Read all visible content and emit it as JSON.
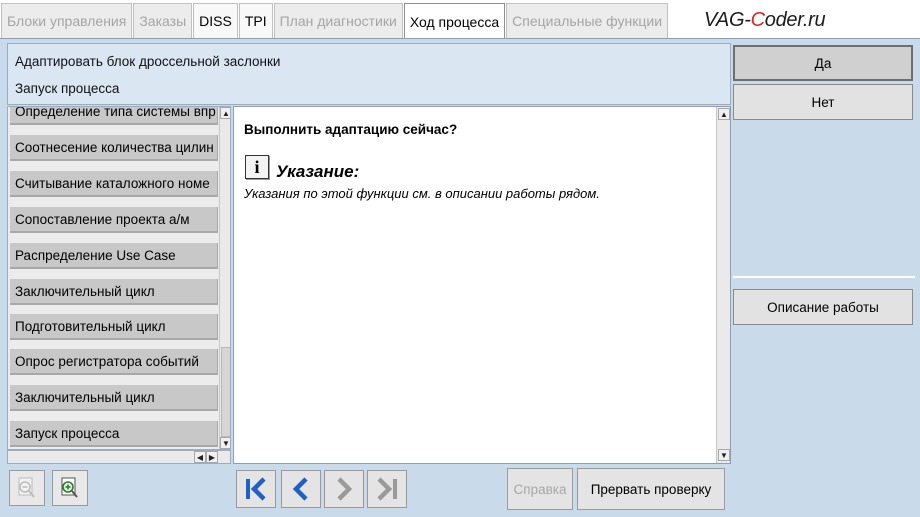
{
  "tabs": [
    {
      "label": "Блоки управления",
      "state": "disabled"
    },
    {
      "label": "Заказы",
      "state": "disabled"
    },
    {
      "label": "DISS",
      "state": "enabled"
    },
    {
      "label": "TPI",
      "state": "enabled"
    },
    {
      "label": "План диагностики",
      "state": "disabled"
    },
    {
      "label": "Ход процесса",
      "state": "active"
    },
    {
      "label": "Специальные функции",
      "state": "disabled"
    }
  ],
  "watermark": {
    "part1": "VAG-",
    "part2": "C",
    "part3": "oder.ru"
  },
  "header": {
    "line1": "Адаптировать блок дроссельной заслонки",
    "line2": "Запуск процесса"
  },
  "steps": [
    "Определение типа системы впр",
    "Соотнесение количества цилин",
    "Считывание каталожного номе",
    "Сопоставление проекта а/м",
    "Распределение Use Case",
    "Заключительный цикл",
    "Подготовительный цикл",
    "Опрос регистратора событий",
    "Заключительный цикл",
    "Запуск процесса"
  ],
  "content": {
    "question": "Выполнить адаптацию сейчас?",
    "info_glyph": "i",
    "note_title": "Указание:",
    "note_text": "Указания по этой функции см. в описании работы рядом."
  },
  "right_panel": {
    "yes_label": "Да",
    "no_label": "Нет",
    "description_label": "Описание работы"
  },
  "toolbar": {
    "help_label": "Справка",
    "abort_label": "Прервать проверку"
  },
  "colors": {
    "frame_bg": "#c9daea",
    "header_bg": "#dae6f2",
    "nav_blue": "#1f5fc8",
    "nav_gray": "#9a9a9a",
    "watermark_accent": "#d8261e"
  },
  "icons": {
    "zoom_out": "zoom-out-icon",
    "zoom_in": "zoom-in-icon",
    "first": "skip-to-first-icon",
    "back": "chevron-left-icon",
    "forward": "chevron-right-icon",
    "last": "skip-to-last-icon",
    "info": "info-icon"
  }
}
